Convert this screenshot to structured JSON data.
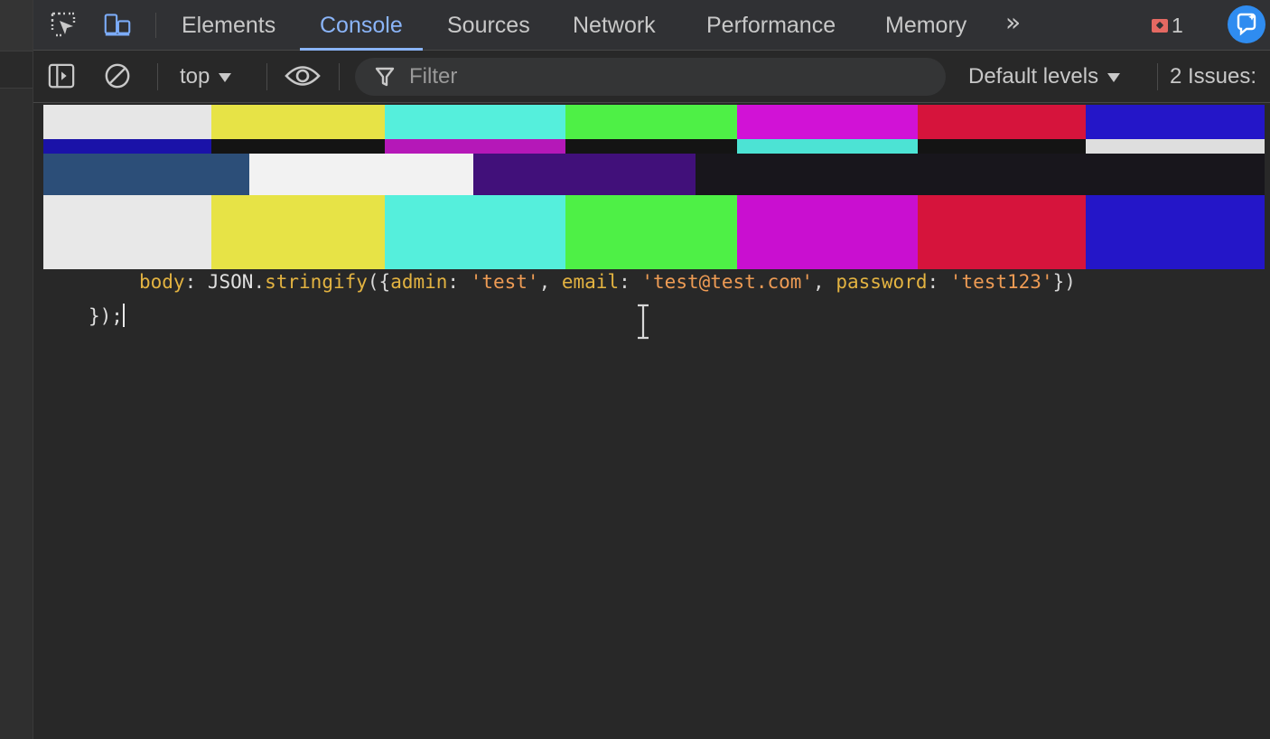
{
  "tabs": [
    {
      "label": "Elements",
      "active": false
    },
    {
      "label": "Console",
      "active": true
    },
    {
      "label": "Sources",
      "active": false
    },
    {
      "label": "Network",
      "active": false
    },
    {
      "label": "Performance",
      "active": false
    },
    {
      "label": "Memory",
      "active": false
    }
  ],
  "tabbar": {
    "more_tabs_glyph": "»",
    "error_count": "1",
    "icons": {
      "inspect": "inspect-element-icon",
      "device": "device-toolbar-icon",
      "more": "more-tabs-icon",
      "error": "error-icon",
      "assistant": "ai-assistant-icon"
    }
  },
  "console_toolbar": {
    "context": "top",
    "filter_placeholder": "Filter",
    "levels_label": "Default levels",
    "issues_label": "2 Issues:",
    "icons": {
      "sidebar": "sidebar-toggle-icon",
      "clear": "clear-console-icon",
      "live_expression": "eye-icon",
      "filter": "filter-funnel-icon"
    }
  },
  "console": {
    "line1": {
      "key": "body",
      "colon": ": ",
      "obj": "JSON",
      "dot": ".",
      "method": "stringify",
      "open": "({",
      "k1": "admin",
      "s1": "'test'",
      "k2": "email",
      "s2": "'test@test.com'",
      "k3": "password",
      "s3": "'test123'",
      "close": "})"
    },
    "line2": "});"
  },
  "colors": {
    "accent": "#8ab4f8",
    "error": "#e46962",
    "assistant": "#2f8cf0",
    "string": "#ee9b54",
    "key": "#e3b341"
  }
}
